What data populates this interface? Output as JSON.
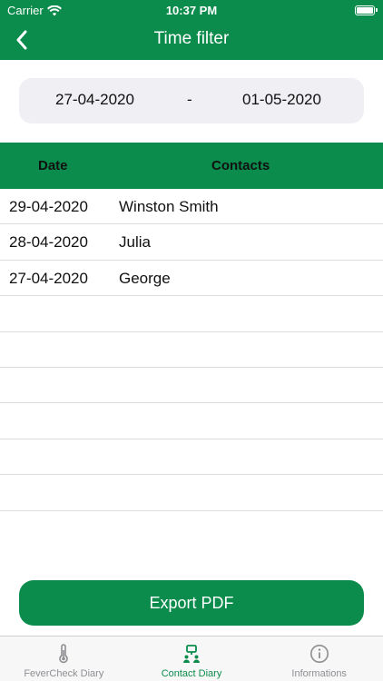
{
  "status_bar": {
    "carrier": "Carrier",
    "time": "10:37 PM"
  },
  "nav": {
    "title": "Time filter"
  },
  "date_range": {
    "from": "27-04-2020",
    "separator": "-",
    "to": "01-05-2020"
  },
  "table": {
    "headers": {
      "date": "Date",
      "contacts": "Contacts"
    },
    "rows": [
      {
        "date": "29-04-2020",
        "contact": "Winston Smith"
      },
      {
        "date": "28-04-2020",
        "contact": "Julia"
      },
      {
        "date": "27-04-2020",
        "contact": "George"
      },
      {
        "date": "",
        "contact": ""
      },
      {
        "date": "",
        "contact": ""
      },
      {
        "date": "",
        "contact": ""
      },
      {
        "date": "",
        "contact": ""
      },
      {
        "date": "",
        "contact": ""
      },
      {
        "date": "",
        "contact": ""
      },
      {
        "date": "",
        "contact": ""
      }
    ]
  },
  "export": {
    "label": "Export PDF"
  },
  "tab_bar": {
    "tabs": [
      {
        "label": "FeverCheck Diary",
        "icon": "thermometer-icon",
        "active": false
      },
      {
        "label": "Contact Diary",
        "icon": "contacts-icon",
        "active": true
      },
      {
        "label": "Informations",
        "icon": "info-icon",
        "active": false
      }
    ]
  },
  "colors": {
    "accent": "#0b8c4c",
    "inactive": "#8e8e93",
    "date_field_bg": "#efeff4"
  }
}
